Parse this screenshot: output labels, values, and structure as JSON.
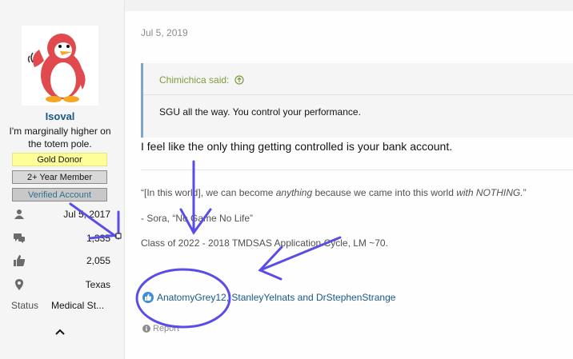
{
  "user": {
    "name": "Isoval",
    "title": "I'm marginally higher on the totem pole.",
    "banners": [
      "Gold Donor",
      "2+ Year Member",
      "Verified Account"
    ],
    "stats": {
      "joined": "Jul 5, 2017",
      "messages": "1,335",
      "reactions": "2,055",
      "location": "Texas",
      "status_label": "Status",
      "status_value": "Medical St..."
    },
    "avatar_icon": "penguin-avatar-icon"
  },
  "post": {
    "date": "Jul 5, 2019",
    "quote": {
      "author": "Chimichica said:",
      "body": "SGU all the way. You control your performance."
    },
    "message": "I feel like the only thing getting controlled is your bank account.",
    "signature": {
      "quote_prefix": "“[In this world], we can become ",
      "quote_em1": "anything",
      "quote_mid": " because we came into this world ",
      "quote_em2": "with NOTHING.",
      "quote_end": "”",
      "attribution": "- Sora, “No Game No Life”",
      "class_line": "Class of 2022 - 2018 TMDSAS Application Cycle, LM ~70."
    },
    "reactions_text": "AnatomyGrey12, StanleyYelnats and DrStephenStrange",
    "report_label": "Report"
  },
  "colors": {
    "link": "#185886",
    "quote_author": "#7f9a3b",
    "annotation": "#5a4de6",
    "gold_banner": "#ffff99"
  }
}
